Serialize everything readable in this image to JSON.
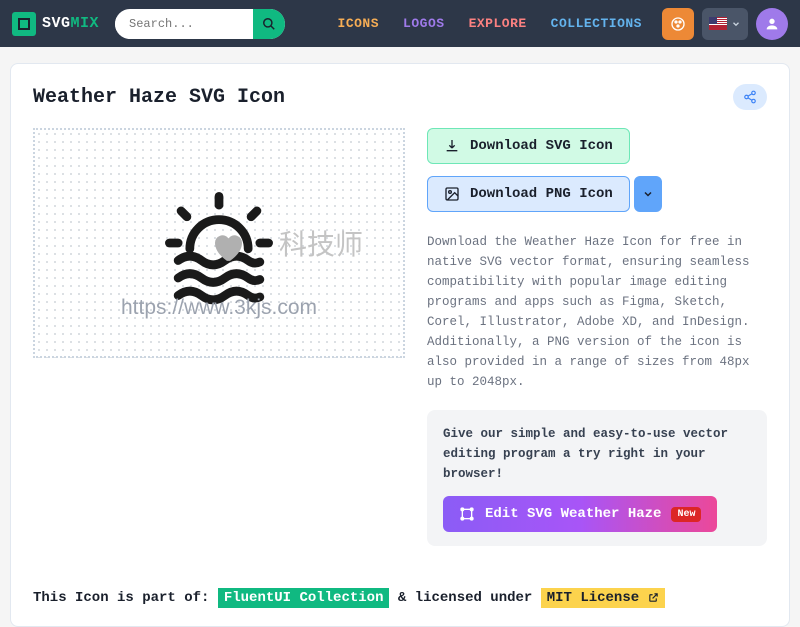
{
  "logo": {
    "part1": "SVG",
    "part2": "MIX"
  },
  "search": {
    "placeholder": "Search..."
  },
  "nav": {
    "icons": "ICONS",
    "logos": "LOGOS",
    "explore": "EXPLORE",
    "collections": "COLLECTIONS"
  },
  "page": {
    "title": "Weather Haze SVG Icon",
    "download_svg": "Download SVG Icon",
    "download_png": "Download PNG Icon",
    "description": "Download the Weather Haze Icon for free in native SVG vector format, ensuring seamless compatibility with popular image editing programs and apps such as Figma, Sketch, Corel, Illustrator, Adobe XD, and InDesign. Additionally, a PNG version of the icon is also provided in a range of sizes from 48px up to 2048px.",
    "editor_text": "Give our simple and easy-to-use vector editing program a try right in your browser!",
    "edit_btn": "Edit SVG Weather Haze",
    "new_badge": "New",
    "watermark": "https://www.3kjs.com",
    "watermark_cn": "科技师"
  },
  "footer": {
    "prefix": "This Icon is part of:",
    "collection": "FluentUI Collection",
    "mid": "& licensed under",
    "license": "MIT License"
  }
}
